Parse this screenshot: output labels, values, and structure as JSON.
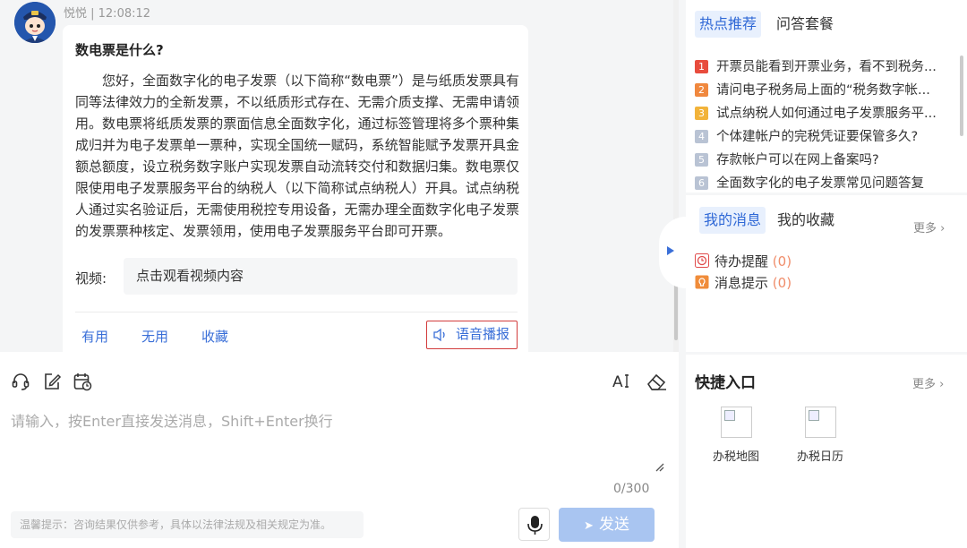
{
  "chat": {
    "meta": "悦悦 | 12:08:12",
    "question": "数电票是什么?",
    "answer": "您好，全面数字化的电子发票（以下简称“数电票”）是与纸质发票具有同等法律效力的全新发票，不以纸质形式存在、无需介质支撑、无需申请领用。数电票将纸质发票的票面信息全面数字化，通过标签管理将多个票种集成归并为电子发票单一票种，实现全国统一赋码，系统智能赋予发票开具金额总额度，设立税务数字账户实现发票自动流转交付和数据归集。数电票仅限使用电子发票服务平台的纳税人（以下简称试点纳税人）开具。试点纳税人通过实名验证后，无需使用税控专用设备，无需办理全面数字化电子发票的发票票种核定、发票领用，使用电子发票服务平台即可开票。",
    "video_label": "视频:",
    "video_link": "点击观看视频内容",
    "useful": "有用",
    "useless": "无用",
    "favorite": "收藏",
    "voice": "语音播报"
  },
  "composer": {
    "placeholder": "请输入，按Enter直接发送消息，Shift+Enter换行",
    "counter": "0/300",
    "tip": "温馨提示：咨询结果仅供参考，具体以法律法规及相关规定为准。",
    "send": "发送"
  },
  "hot": {
    "tab_active": "热点推荐",
    "tab2": "问答套餐",
    "items": [
      {
        "n": "1",
        "text": "开票员能看到开票业务，看不到税务..."
      },
      {
        "n": "2",
        "text": "请问电子税务局上面的“税务数字帐..."
      },
      {
        "n": "3",
        "text": "试点纳税人如何通过电子发票服务平..."
      },
      {
        "n": "4",
        "text": "个体建帐户的完税凭证要保管多久?"
      },
      {
        "n": "5",
        "text": "存款帐户可以在网上备案吗?"
      },
      {
        "n": "6",
        "text": "全面数字化的电子发票常见问题答复"
      }
    ],
    "colors": [
      "#e84c3d",
      "#f0883e",
      "#f2b33a",
      "#b9c3d4",
      "#b9c3d4",
      "#b9c3d4"
    ]
  },
  "messages": {
    "tab_active": "我的消息",
    "tab2": "我的收藏",
    "more": "更多",
    "todo": "待办提醒",
    "todo_count": "(0)",
    "notice": "消息提示",
    "notice_count": "(0)"
  },
  "quick": {
    "title": "快捷入口",
    "more": "更多",
    "entries": [
      "办税地图",
      "办税日历"
    ]
  }
}
